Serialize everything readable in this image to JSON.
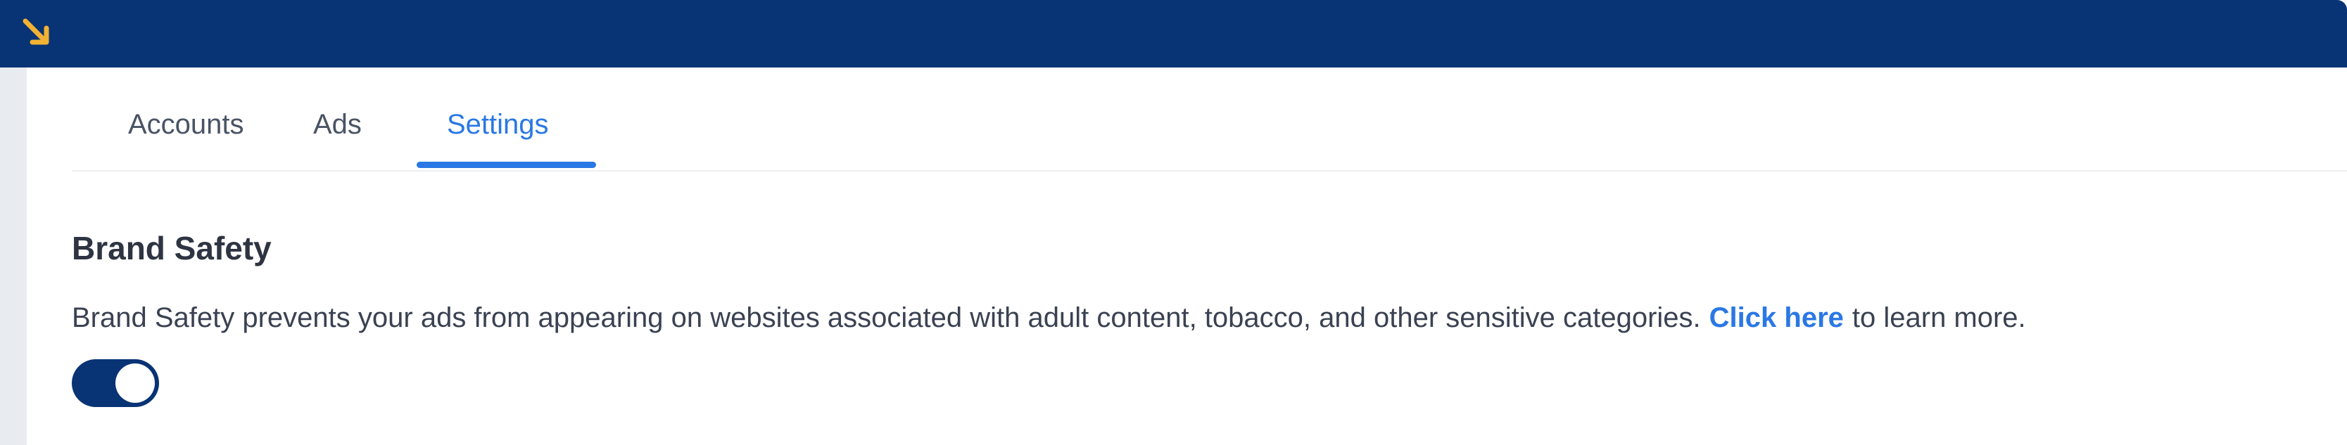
{
  "header": {
    "icon": "arrow-down-right-icon",
    "background_color": "#083374",
    "icon_color": "#f2b233"
  },
  "tabs": [
    {
      "label": "Accounts",
      "active": false
    },
    {
      "label": "Ads",
      "active": false
    },
    {
      "label": "Settings",
      "active": true
    }
  ],
  "section": {
    "title": "Brand Safety",
    "description_before": "Brand Safety prevents your ads from appearing on websites associated with adult content, tobacco, and other sensitive categories.",
    "link_text": "Click here",
    "description_after": "to learn more.",
    "toggle_on": true
  },
  "colors": {
    "accent": "#2a78e4",
    "toggle_on": "#083374"
  }
}
